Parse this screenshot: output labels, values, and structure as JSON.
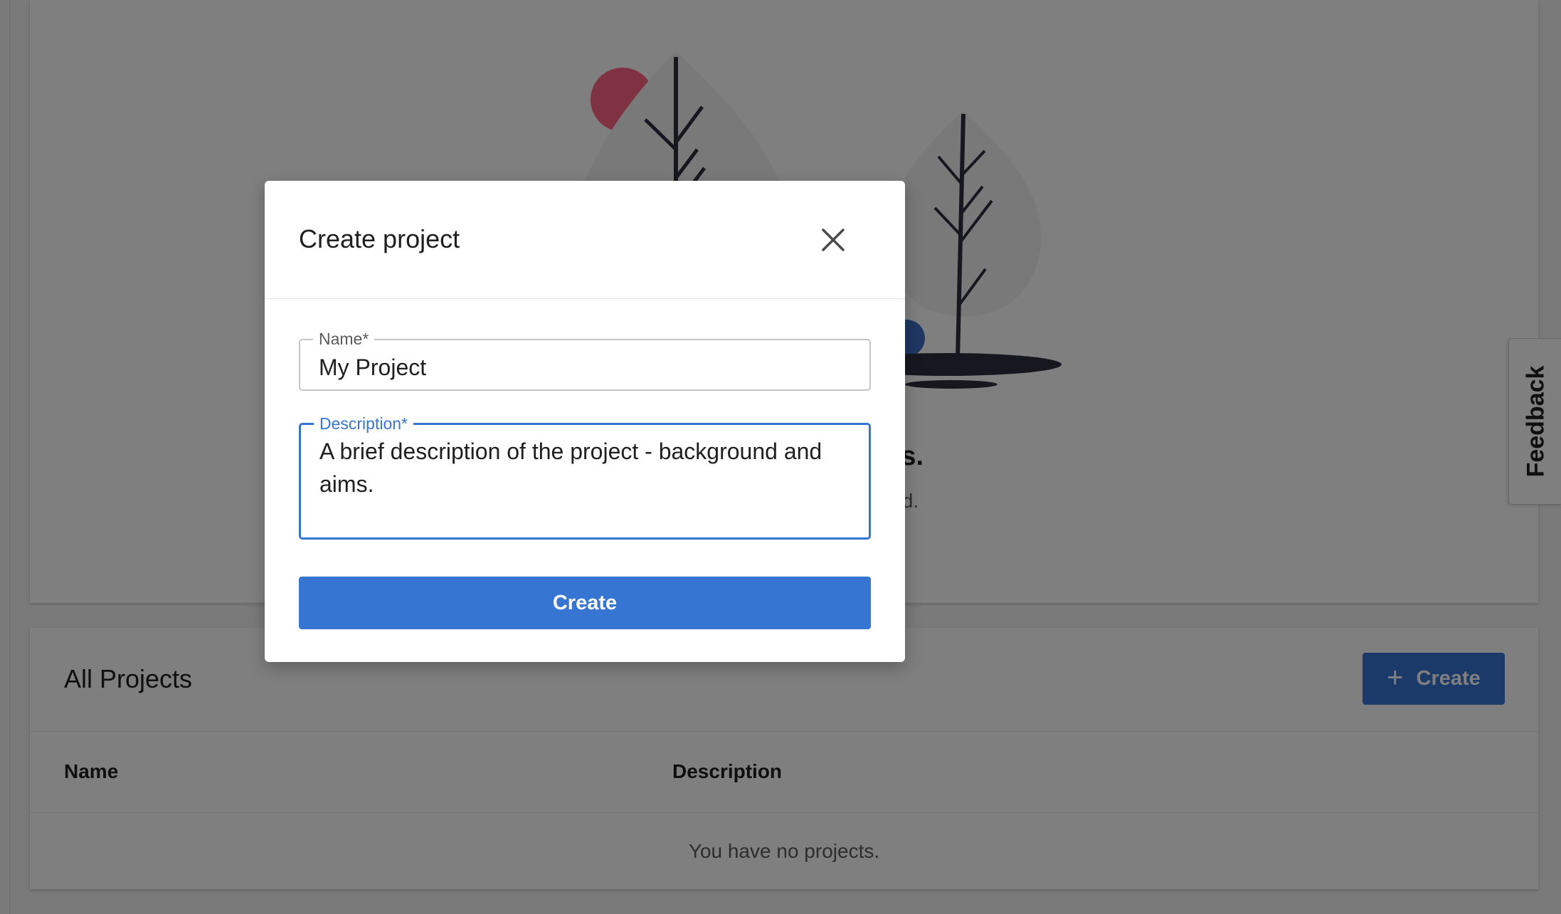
{
  "hero": {
    "title": "You have no projects.",
    "subtitle": "Create a project to get started."
  },
  "projects": {
    "title": "All Projects",
    "create_label": "Create",
    "columns": {
      "name": "Name",
      "description": "Description"
    },
    "empty_text": "You have no projects."
  },
  "feedback": {
    "label": "Feedback"
  },
  "modal": {
    "title": "Create project",
    "name_field": {
      "label": "Name",
      "required_marker": "*",
      "value": "My Project"
    },
    "description_field": {
      "label": "Description",
      "required_marker": "*",
      "value": "A brief description of the project - background and aims."
    },
    "submit_label": "Create"
  },
  "colors": {
    "primary": "#3775d2",
    "focus_border": "#3775d2",
    "overlay": "rgba(0,0,0,0.5)",
    "illustration_dark": "#2f2e41",
    "illustration_accent": "#ff6584",
    "illustration_leaf": "#f2f2f2"
  },
  "icons": {
    "close": "close-icon",
    "plus": "plus-icon"
  }
}
